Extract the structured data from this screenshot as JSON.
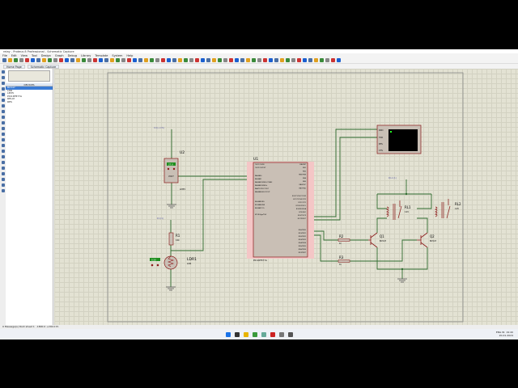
{
  "window": {
    "title": "relay - Proteus 8 Professional - Schematic Capture"
  },
  "menu": [
    "File",
    "Edit",
    "View",
    "Tool",
    "Design",
    "Graph",
    "Debug",
    "Library",
    "Template",
    "System",
    "Help"
  ],
  "tabs": [
    "Home Page",
    "Schematic Capture"
  ],
  "devices": {
    "header": "DEVICES",
    "mode_buttons": [
      "P",
      "L"
    ],
    "items": [
      "BC547",
      "LDR",
      "LM35",
      "PIC16F877A",
      "RELAY",
      "RES"
    ],
    "selected": 0
  },
  "schematic": {
    "u1": {
      "ref": "U1",
      "part": "PIC16F877A",
      "left_pins": [
        "OSC1/CLKIN",
        "OSC2/CLKOUT",
        "RA0/AN0",
        "RA1/AN1",
        "RA2/AN2/VREF-/CVREF",
        "RA3/AN3/VREF+",
        "RA4/T0CKI/C1OUT",
        "RA5/AN4/SS/C2OUT",
        "RE0/AN5/RD",
        "RE1/AN6/WR",
        "RE2/AN7/CS",
        "MCLR/Vpp/THV"
      ],
      "right_pins": [
        "RB0/INT",
        "RB1",
        "RB2",
        "RB3/PGM",
        "RB4",
        "RB5",
        "RB6/PGC",
        "RB7/PGD",
        "RC0/T1OSO/T1CKI",
        "RC1/T1OSI/CCP2",
        "RC2/CCP1",
        "RC3/SCK/SCL",
        "RC4/SDI/SDA",
        "RC5/SDO",
        "RC6/TX/CK",
        "RC7/RX/DT",
        "RD0/PSP0",
        "RD1/PSP1",
        "RD2/PSP2",
        "RD3/PSP3",
        "RD4/PSP4",
        "RD5/PSP5",
        "RD6/PSP6",
        "RD7/PSP7"
      ]
    },
    "u2": {
      "ref": "U2",
      "part": "LM35",
      "pin": "VOUT",
      "probe": "U2(+VS)",
      "reading": "27.0"
    },
    "r1": {
      "ref": "R1",
      "value": "10k",
      "probe": "R1(1)"
    },
    "ldr1": {
      "ref": "LDR1",
      "value": "LDR",
      "reading": "0.50"
    },
    "r2": {
      "ref": "R2",
      "value": "1k"
    },
    "r3": {
      "ref": "R3",
      "value": "1k"
    },
    "q1": {
      "ref": "Q1",
      "part": "BC547"
    },
    "q2": {
      "ref": "Q2",
      "part": "BC547"
    },
    "rl1": {
      "ref": "RL1",
      "value": "12V"
    },
    "rl2": {
      "ref": "RL2",
      "value": "12V"
    },
    "relay_probe": "RL1(1)",
    "terminal": {
      "pins": [
        "RXD",
        "TXD",
        "RTS",
        "CTS"
      ]
    }
  },
  "status": {
    "text": "0 Message(s)  Root sheet 1",
    "coords": "-1800.0   +200.0  th"
  },
  "taskbar": {
    "time": "19:40",
    "date": "20-01-2024",
    "lang": "ENG IN"
  },
  "colors": {
    "wire": "#2e6b2e",
    "component": "#8b1a1a",
    "pins_bg": "#f4c6c6",
    "body": "#c9bfb5",
    "terminal_screen": "#000000",
    "indicator": "#1f8f1f"
  }
}
